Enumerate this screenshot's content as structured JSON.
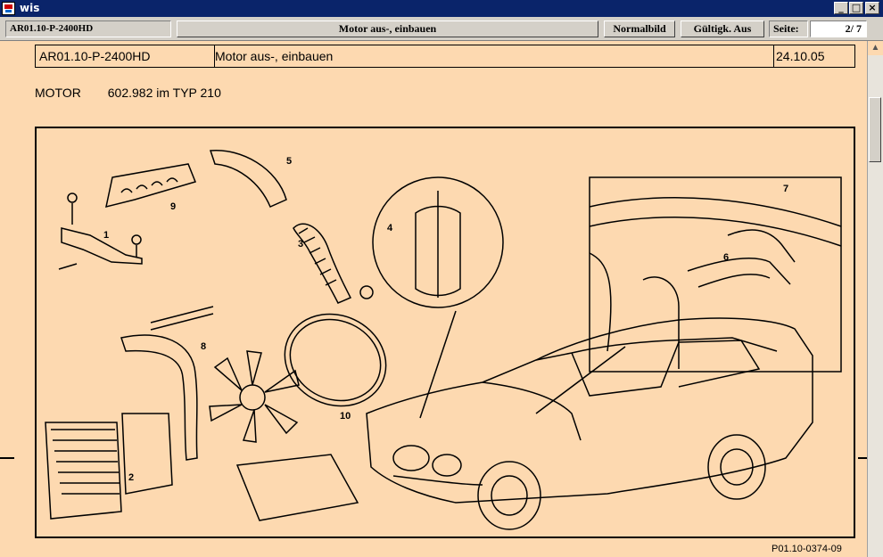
{
  "window": {
    "title": "wis",
    "minimize": "_",
    "maximize": "□",
    "close": "×"
  },
  "toolbar": {
    "doc_id": "AR01.10-P-2400HD",
    "doc_title": "Motor aus-, einbauen",
    "normalbild_label": "Normalbild",
    "gueltigk_label": "Gültigk. Aus",
    "seite_label": "Seite:",
    "page_value": "2/ 7"
  },
  "document": {
    "header": {
      "id": "AR01.10-P-2400HD",
      "title": "Motor aus-, einbauen",
      "date": "24.10.05"
    },
    "motor_label": "MOTOR",
    "motor_spec": "602.982 im TYP 210",
    "figure_ref": "P01.10-0374-09",
    "figure_callouts": [
      "1",
      "2",
      "3",
      "4",
      "5",
      "6",
      "7",
      "8",
      "9",
      "10"
    ]
  },
  "scrollbar": {
    "up_arrow": "▲"
  }
}
